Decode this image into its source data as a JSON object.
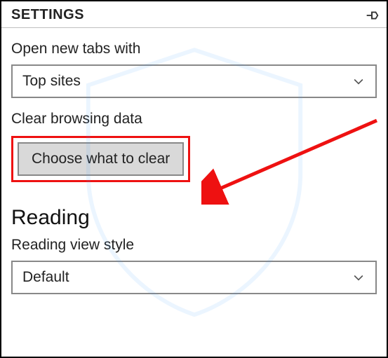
{
  "header": {
    "title": "SETTINGS"
  },
  "open_tabs": {
    "label": "Open new tabs with",
    "value": "Top sites"
  },
  "clear_data": {
    "label": "Clear browsing data",
    "button": "Choose what to clear"
  },
  "reading": {
    "heading": "Reading",
    "style_label": "Reading view style",
    "style_value": "Default"
  }
}
